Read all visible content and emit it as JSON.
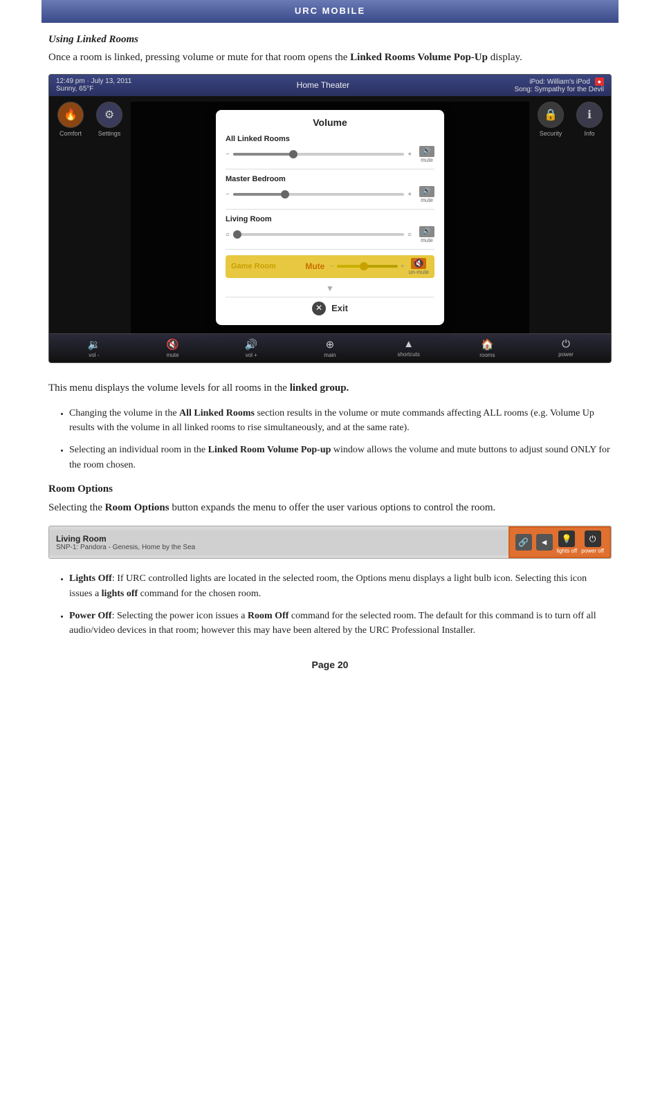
{
  "header": {
    "title": "URC Mobile"
  },
  "section1": {
    "title": "Using Linked Rooms",
    "intro": "Once a room is linked, pressing volume or mute for that room opens the ",
    "intro_bold": "Linked Rooms Volume Pop-Up",
    "intro_end": " display."
  },
  "ui": {
    "topbar": {
      "time": "12:49 pm · July 13, 2011",
      "weather": "Sunny, 65°F",
      "room": "Home Theater",
      "ipod_label": "iPod:",
      "ipod_name": "William's iPod",
      "song_label": "Song:",
      "song_name": "Sympathy for the Devil"
    },
    "nav_items": [
      {
        "label": "Comfort",
        "icon": "🔥"
      },
      {
        "label": "Settings",
        "icon": "⚙"
      },
      {
        "label": "Security",
        "icon": "🔒"
      },
      {
        "label": "Info",
        "icon": "ℹ"
      }
    ],
    "volume_popup": {
      "title": "Volume",
      "rows": [
        {
          "label": "All Linked Rooms",
          "fill_pct": 35,
          "thumb_pct": 35,
          "muted": false
        },
        {
          "label": "Master Bedroom",
          "fill_pct": 30,
          "thumb_pct": 30,
          "muted": false
        },
        {
          "label": "Living Room",
          "fill_pct": 0,
          "thumb_pct": 0,
          "muted": false
        }
      ],
      "game_room_label": "Game Room",
      "game_room_mute_text": "Mute",
      "exit_label": "Exit"
    },
    "toolbar": [
      {
        "label": "vol -",
        "icon": "🔉"
      },
      {
        "label": "mute",
        "icon": "🔇"
      },
      {
        "label": "vol +",
        "icon": "🔊"
      },
      {
        "label": "main",
        "icon": "⊕"
      },
      {
        "label": "shortcuts",
        "icon": "▲"
      },
      {
        "label": "rooms",
        "icon": "🏠"
      },
      {
        "label": "power",
        "icon": "⏻"
      }
    ]
  },
  "body": {
    "para1_pre": "This menu displays the volume levels for all rooms in the ",
    "para1_bold": "linked group.",
    "bullets": [
      {
        "pre": "Changing the volume in the ",
        "bold": "All Linked Rooms",
        "post": " section results in the volume or mute commands affecting ALL rooms (e.g. Volume Up results with the volume in all linked rooms to rise simultaneously, and at the same rate)."
      },
      {
        "pre": "Selecting an individual room in the ",
        "bold": "Linked Room Volume Pop-up",
        "post": " window allows the volume and mute buttons to adjust sound ONLY for the room chosen."
      }
    ]
  },
  "room_options": {
    "section_title": "Room Options",
    "para": "Selecting the ",
    "para_bold": "Room Options",
    "para_end": " button expands the menu to offer the user various options to control the room.",
    "room_bar": {
      "name": "Living Room",
      "song": "SNP-1: Pandora - Genesis, Home by the Sea",
      "buttons": [
        {
          "icon": "🔗",
          "label": ""
        },
        {
          "icon": "◄",
          "label": ""
        },
        {
          "icon": "💡",
          "label": "lights off"
        },
        {
          "icon": "⏻",
          "label": "power off"
        }
      ]
    },
    "bullets": [
      {
        "pre": "",
        "bold": "Lights Off",
        "post": ": If URC controlled lights are located in the selected room, the Options menu displays a light bulb icon. Selecting this icon issues a ",
        "bold2": "lights off",
        "post2": " command for the chosen room."
      },
      {
        "pre": "",
        "bold": "Power Off",
        "post": ": Selecting the power icon issues a ",
        "bold2": "Room Off",
        "post2": " command for the selected room. The default for this command is to turn off all audio/video devices in that room; however this may have been altered by the URC Professional Installer."
      }
    ]
  },
  "footer": {
    "page_label": "Page 20"
  }
}
